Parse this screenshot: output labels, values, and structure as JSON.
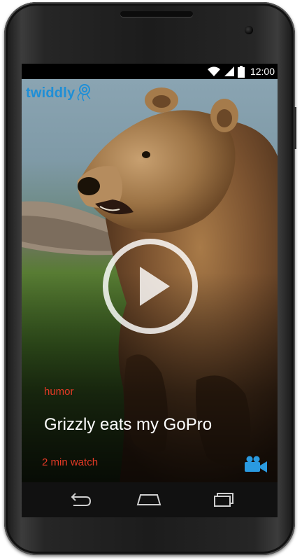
{
  "status_bar": {
    "time": "12:00",
    "icons": [
      "wifi-icon",
      "signal-icon",
      "battery-icon"
    ]
  },
  "app": {
    "logo": "twiddly"
  },
  "video_card": {
    "category": "humor",
    "title": "Grizzly eats my GoPro",
    "duration": "2 min watch",
    "media_type_icon": "video-camera-icon",
    "play_icon": "play-icon"
  },
  "nav_bar": {
    "buttons": [
      "back-icon",
      "home-icon",
      "recent-apps-icon"
    ]
  },
  "colors": {
    "brand": "#1f8fd6",
    "accent": "#e53a26",
    "title": "#ffffff"
  }
}
